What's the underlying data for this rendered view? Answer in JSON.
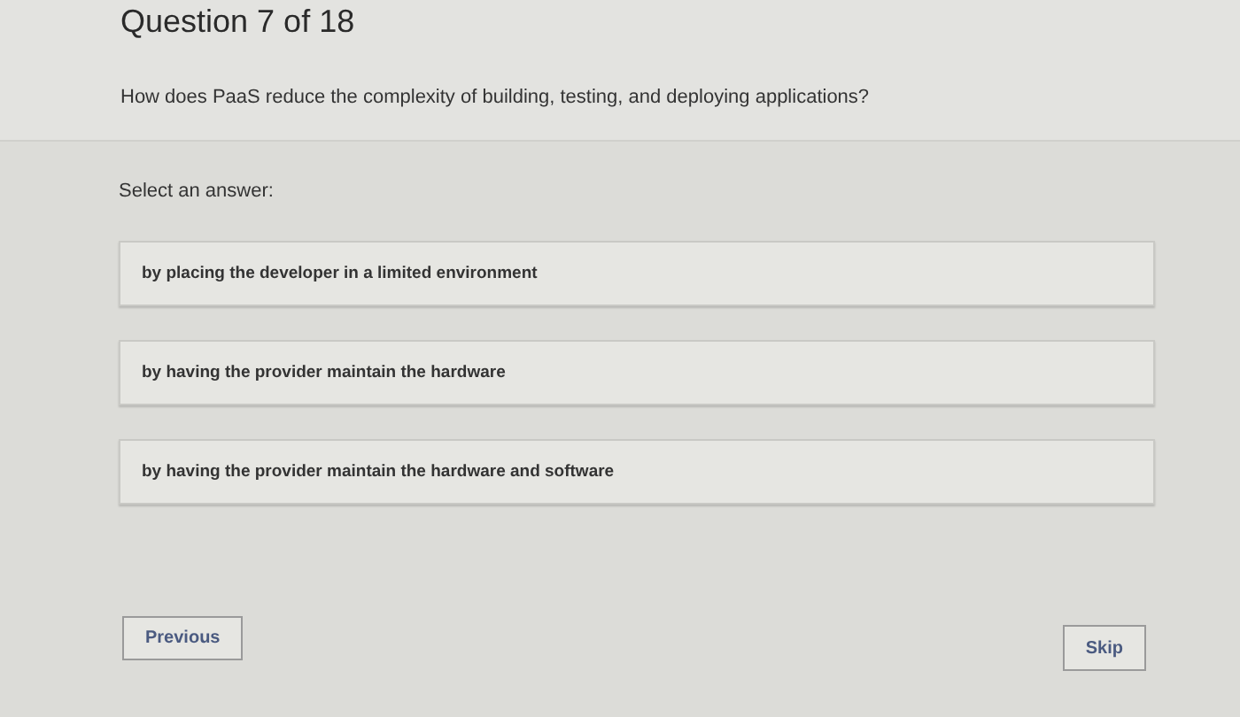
{
  "header": {
    "title": "Question 7 of 18",
    "question": "How does PaaS reduce the complexity of building, testing, and deploying applications?"
  },
  "prompt": "Select an answer:",
  "answers": [
    "by placing the developer in a limited environment",
    "by having the provider maintain the hardware",
    "by having the provider maintain the hardware and software"
  ],
  "buttons": {
    "previous": "Previous",
    "skip": "Skip"
  }
}
